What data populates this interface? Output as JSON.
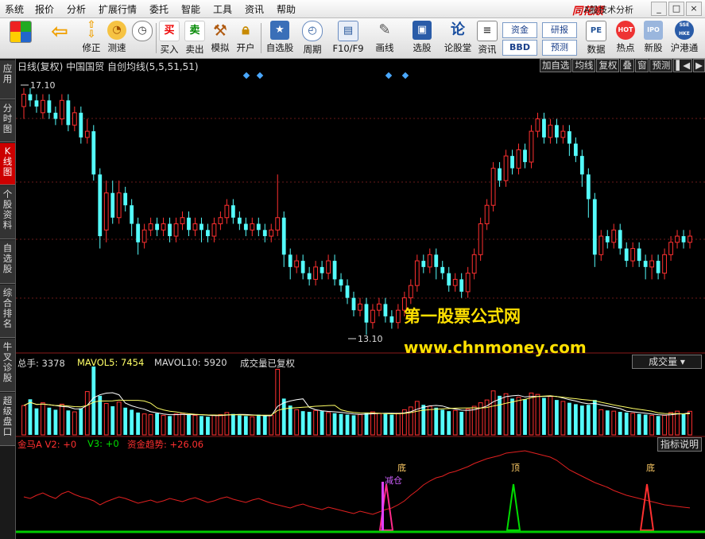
{
  "menu": {
    "items": [
      "系统",
      "报价",
      "分析",
      "扩展行情",
      "委托",
      "智能",
      "工具",
      "资讯",
      "帮助"
    ],
    "brand": "同花顺",
    "brand_sub": "- A股技术分析",
    "window_controls": [
      "_",
      "□",
      "×"
    ]
  },
  "toolbar": {
    "buttons": [
      {
        "label": "",
        "icon": "grid-icon"
      },
      {
        "label": "",
        "icon": "back-arrow-icon"
      },
      {
        "label": "修正",
        "icon": "up-down-arrow-icon"
      },
      {
        "label": "测速",
        "icon": "clock-icon"
      },
      {
        "label": "买入",
        "icon": "buy-icon",
        "glyph": "买"
      },
      {
        "label": "卖出",
        "icon": "sell-icon",
        "glyph": "卖"
      },
      {
        "label": "模拟",
        "icon": "hammer-icon"
      },
      {
        "label": "开户",
        "icon": "lock-icon"
      },
      {
        "label": "自选股",
        "icon": "star-folder-icon"
      },
      {
        "label": "周期",
        "icon": "period-clock-icon"
      },
      {
        "label": "F10/F9",
        "icon": "f10-icon"
      },
      {
        "label": "画线",
        "icon": "pencil-icon"
      },
      {
        "label": "选股",
        "icon": "monitor-icon"
      },
      {
        "label": "论股堂",
        "icon": "lun-icon",
        "glyph": "论"
      },
      {
        "label": "资讯",
        "icon": "document-icon"
      },
      {
        "label": "数据",
        "icon": "pe-icon",
        "glyph": "PE"
      },
      {
        "label": "热点",
        "icon": "hot-icon",
        "glyph": "HOT"
      },
      {
        "label": "新股",
        "icon": "new-stock-icon",
        "glyph": "IPO"
      },
      {
        "label": "沪港通",
        "icon": "hk-connect-icon",
        "glyph": "SSE HKE"
      }
    ],
    "small_buttons": [
      "资金",
      "研报",
      "BBD",
      "预测"
    ]
  },
  "left_tabs": [
    {
      "label": "应用",
      "active": false
    },
    {
      "label": "分时图",
      "active": false
    },
    {
      "label": "K线图",
      "active": true
    },
    {
      "label": "个股资料",
      "active": false
    },
    {
      "label": "自选股",
      "active": false
    },
    {
      "label": "综合排名",
      "active": false
    },
    {
      "label": "牛叉诊股",
      "active": false
    },
    {
      "label": "超级盘口",
      "active": false
    }
  ],
  "kline": {
    "title": "日线(复权)  中国国贸  自创均线(5,5,51,51)",
    "buttons": [
      "加自选",
      "均线",
      "复权",
      "叠",
      "窗",
      "预测",
      "▌◀",
      "▶"
    ],
    "high_label": "17.10",
    "low_label": "13.10",
    "colors": {
      "up": "#ff3030",
      "down": "#54fcfc",
      "grid": "#6a1a1a",
      "marker": "#4aa8ff"
    }
  },
  "volume": {
    "label_total": "总手: 3378",
    "label_mavol5": "MAVOL5: 7454",
    "label_mavol10": "MAVOL10: 5920",
    "note": "成交量已复权",
    "select": "成交量"
  },
  "indicator": {
    "label_a": "金马A V2: +0",
    "label_v3": "V3: +0",
    "label_fund": "资金趋势: +26.06",
    "button": "指标说明",
    "signals": [
      "底",
      "顶",
      "底"
    ],
    "signal_note": "减仓"
  },
  "watermark": {
    "line1": "第一股票公式网",
    "line2": "www.chnmoney.com"
  },
  "chart_data": {
    "type": "candlestick",
    "title": "日线(复权) 中国国贸",
    "price_markers": {
      "high": 17.1,
      "low": 13.1
    },
    "volume_summary": {
      "total": 3378,
      "mavol5": 7454,
      "mavol10": 5920
    },
    "indicator_summary": {
      "v2": 0,
      "v3": 0,
      "fund_trend": 26.06
    },
    "candles": [
      [
        16.8,
        17.0,
        16.6,
        17.1
      ],
      [
        17.0,
        16.9,
        16.8,
        17.1
      ],
      [
        16.9,
        16.8,
        16.7,
        17.0
      ],
      [
        16.7,
        16.9,
        16.6,
        17.0
      ],
      [
        16.9,
        16.7,
        16.6,
        17.0
      ],
      [
        16.7,
        16.6,
        16.5,
        16.8
      ],
      [
        16.6,
        16.9,
        16.5,
        17.0
      ],
      [
        16.9,
        16.5,
        16.4,
        17.0
      ],
      [
        16.5,
        16.7,
        16.4,
        16.8
      ],
      [
        16.7,
        16.3,
        16.2,
        16.8
      ],
      [
        16.3,
        16.4,
        16.2,
        16.6
      ],
      [
        16.4,
        15.7,
        15.6,
        16.5
      ],
      [
        15.7,
        14.7,
        14.5,
        15.8
      ],
      [
        14.8,
        15.4,
        14.6,
        15.6
      ],
      [
        15.4,
        15.0,
        14.9,
        15.6
      ],
      [
        15.0,
        15.4,
        14.9,
        15.6
      ],
      [
        15.4,
        15.2,
        15.1,
        15.5
      ],
      [
        15.2,
        14.9,
        14.7,
        15.3
      ],
      [
        14.9,
        14.6,
        14.4,
        15.0
      ],
      [
        14.6,
        14.8,
        14.5,
        14.9
      ],
      [
        14.8,
        14.9,
        14.7,
        15.0
      ],
      [
        14.9,
        14.8,
        14.7,
        15.0
      ],
      [
        14.8,
        14.9,
        14.7,
        15.0
      ],
      [
        14.9,
        14.7,
        14.6,
        15.0
      ],
      [
        14.7,
        14.9,
        14.6,
        15.0
      ],
      [
        14.9,
        15.0,
        14.8,
        15.1
      ],
      [
        15.0,
        14.8,
        14.7,
        15.1
      ],
      [
        14.8,
        14.9,
        14.7,
        15.0
      ],
      [
        14.9,
        14.8,
        14.6,
        15.0
      ],
      [
        14.8,
        14.7,
        14.6,
        14.9
      ],
      [
        14.7,
        14.9,
        14.6,
        15.0
      ],
      [
        14.9,
        15.0,
        14.8,
        15.1
      ],
      [
        15.0,
        15.2,
        14.9,
        15.3
      ],
      [
        15.2,
        15.0,
        14.9,
        15.3
      ],
      [
        15.0,
        14.9,
        14.8,
        15.1
      ],
      [
        14.9,
        14.8,
        14.7,
        15.0
      ],
      [
        14.8,
        14.9,
        14.7,
        15.0
      ],
      [
        14.9,
        14.8,
        14.7,
        15.0
      ],
      [
        14.8,
        14.7,
        14.6,
        14.9
      ],
      [
        14.7,
        14.8,
        14.6,
        14.9
      ],
      [
        14.8,
        15.0,
        14.7,
        15.7
      ],
      [
        15.0,
        14.4,
        14.2,
        15.1
      ],
      [
        14.4,
        14.2,
        14.0,
        14.5
      ],
      [
        14.2,
        14.3,
        14.1,
        14.4
      ],
      [
        14.3,
        14.1,
        14.0,
        14.4
      ],
      [
        14.1,
        14.0,
        13.9,
        14.2
      ],
      [
        14.0,
        14.2,
        13.9,
        14.3
      ],
      [
        14.2,
        14.1,
        14.0,
        14.3
      ],
      [
        14.1,
        14.3,
        14.0,
        14.4
      ],
      [
        14.3,
        14.0,
        13.9,
        14.4
      ],
      [
        14.0,
        13.9,
        13.8,
        14.1
      ],
      [
        13.9,
        13.7,
        13.6,
        14.0
      ],
      [
        13.7,
        13.5,
        13.4,
        13.8
      ],
      [
        13.5,
        13.6,
        13.4,
        13.7
      ],
      [
        13.6,
        13.3,
        13.1,
        13.7
      ],
      [
        13.3,
        13.5,
        13.2,
        13.6
      ],
      [
        13.5,
        13.6,
        13.4,
        13.7
      ],
      [
        13.6,
        13.4,
        13.3,
        13.7
      ],
      [
        13.4,
        13.3,
        13.2,
        13.5
      ],
      [
        13.3,
        13.5,
        13.2,
        13.6
      ],
      [
        13.5,
        13.7,
        13.4,
        13.8
      ],
      [
        13.7,
        13.9,
        13.6,
        14.0
      ],
      [
        13.9,
        14.3,
        13.8,
        14.4
      ],
      [
        14.3,
        14.2,
        14.1,
        14.4
      ],
      [
        14.2,
        14.4,
        14.1,
        14.5
      ],
      [
        14.4,
        14.2,
        14.0,
        14.5
      ],
      [
        14.2,
        14.1,
        14.0,
        14.3
      ],
      [
        14.1,
        13.9,
        13.8,
        14.2
      ],
      [
        13.9,
        14.0,
        13.8,
        14.1
      ],
      [
        14.0,
        13.8,
        13.7,
        14.1
      ],
      [
        13.8,
        14.1,
        13.7,
        14.2
      ],
      [
        14.1,
        14.4,
        14.0,
        14.5
      ],
      [
        14.4,
        14.9,
        14.3,
        15.0
      ],
      [
        14.9,
        15.2,
        14.8,
        15.3
      ],
      [
        15.2,
        15.8,
        15.1,
        15.9
      ],
      [
        15.8,
        15.6,
        15.5,
        15.9
      ],
      [
        15.6,
        16.0,
        15.5,
        16.1
      ],
      [
        16.0,
        15.8,
        15.7,
        16.1
      ],
      [
        15.8,
        16.1,
        15.7,
        16.2
      ],
      [
        16.1,
        15.9,
        15.8,
        16.2
      ],
      [
        15.9,
        16.4,
        15.8,
        16.5
      ],
      [
        16.4,
        16.6,
        16.3,
        16.7
      ],
      [
        16.6,
        16.3,
        16.2,
        16.7
      ],
      [
        16.3,
        16.5,
        16.2,
        16.6
      ],
      [
        16.5,
        16.3,
        16.2,
        16.6
      ],
      [
        16.3,
        16.4,
        16.2,
        16.5
      ],
      [
        16.4,
        16.2,
        16.0,
        16.5
      ],
      [
        16.2,
        16.0,
        15.9,
        16.3
      ],
      [
        16.0,
        15.7,
        15.5,
        16.1
      ],
      [
        15.7,
        15.3,
        15.0,
        15.8
      ],
      [
        15.3,
        14.4,
        14.2,
        15.4
      ],
      [
        14.4,
        14.7,
        14.3,
        14.8
      ],
      [
        14.7,
        14.6,
        14.5,
        14.8
      ],
      [
        14.6,
        14.8,
        14.5,
        14.9
      ],
      [
        14.8,
        14.5,
        14.4,
        14.9
      ],
      [
        14.5,
        14.3,
        14.2,
        14.6
      ],
      [
        14.3,
        14.5,
        14.2,
        14.6
      ],
      [
        14.5,
        14.3,
        14.2,
        14.6
      ],
      [
        14.3,
        14.2,
        14.0,
        14.4
      ],
      [
        14.2,
        14.3,
        14.0,
        14.4
      ],
      [
        14.3,
        14.1,
        14.0,
        14.4
      ],
      [
        14.1,
        14.4,
        14.0,
        14.5
      ],
      [
        14.4,
        14.6,
        14.3,
        14.7
      ],
      [
        14.6,
        14.7,
        14.5,
        14.8
      ],
      [
        14.7,
        14.6,
        14.5,
        14.8
      ],
      [
        14.6,
        14.7,
        14.5,
        14.8
      ]
    ],
    "volume": [
      4200,
      5100,
      3800,
      4600,
      3900,
      3600,
      4400,
      3500,
      3300,
      3800,
      6200,
      9800,
      5600,
      4500,
      4100,
      4700,
      3900,
      3600,
      3200,
      3000,
      2900,
      3100,
      2800,
      2700,
      3000,
      3100,
      2900,
      2800,
      2700,
      2600,
      2800,
      2900,
      3200,
      3000,
      2800,
      2700,
      2600,
      2900,
      2700,
      2800,
      9400,
      5200,
      4200,
      3600,
      3400,
      3300,
      3500,
      3400,
      3200,
      3100,
      3000,
      2900,
      2800,
      2900,
      3200,
      3300,
      3100,
      3000,
      2900,
      3100,
      3600,
      4000,
      4800,
      4300,
      4100,
      3900,
      3600,
      3400,
      3500,
      3300,
      3700,
      4100,
      4600,
      5000,
      6300,
      5600,
      5900,
      5200,
      5400,
      5100,
      6000,
      5800,
      5300,
      5500,
      5000,
      4800,
      4600,
      4400,
      4200,
      4300,
      5000,
      3600,
      3500,
      3400,
      3300,
      3200,
      3100,
      3000,
      2900,
      2800,
      2700,
      2800,
      3200,
      3400,
      3000,
      3378
    ],
    "fund_trend": [
      40,
      38,
      42,
      45,
      41,
      38,
      44,
      47,
      43,
      40,
      38,
      35,
      30,
      34,
      37,
      40,
      38,
      35,
      32,
      34,
      36,
      33,
      35,
      38,
      36,
      34,
      37,
      39,
      36,
      33,
      35,
      38,
      40,
      37,
      35,
      33,
      36,
      38,
      35,
      32,
      30,
      28,
      26,
      29,
      31,
      28,
      26,
      24,
      27,
      25,
      23,
      21,
      19,
      22,
      20,
      18,
      21,
      24,
      26,
      30,
      35,
      42,
      48,
      55,
      60,
      64,
      66,
      70,
      72,
      75,
      78,
      82,
      85,
      88,
      90,
      92,
      95,
      96,
      97,
      98,
      96,
      94,
      92,
      90,
      86,
      80,
      74,
      70,
      66,
      62,
      58,
      55,
      52,
      48,
      45,
      42,
      40,
      38,
      36,
      34,
      32,
      30,
      29,
      28,
      27,
      26.06
    ]
  }
}
